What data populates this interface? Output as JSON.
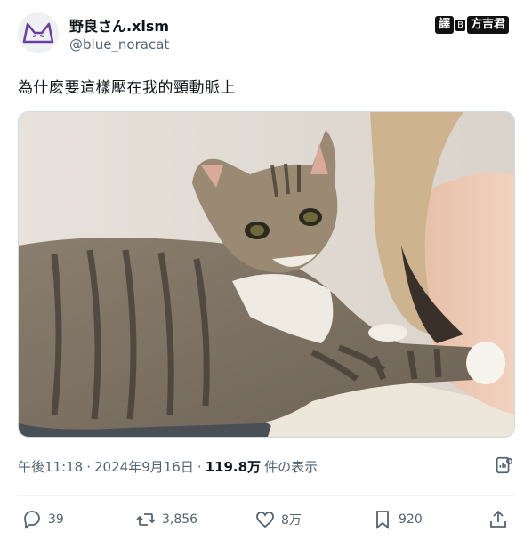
{
  "author": {
    "display_name": "野良さん.xlsm",
    "handle": "@blue_noracat"
  },
  "watermark": {
    "left": "譯",
    "mid": "B",
    "right": "方吉君"
  },
  "tweet": {
    "text": "為什麽要這樣壓在我的頸動脈上"
  },
  "meta": {
    "time": "午後11:18",
    "sep1": "·",
    "date": "2024年9月16日",
    "sep2": "·",
    "views": "119.8万",
    "views_suffix": "件の表示"
  },
  "actions": {
    "replies": "39",
    "retweets": "3,856",
    "likes": "8万",
    "bookmarks": "920"
  },
  "icons": {
    "reply": "reply-icon",
    "retweet": "retweet-icon",
    "like": "heart-icon",
    "bookmark": "bookmark-icon",
    "share": "share-icon",
    "analytics": "analytics-icon"
  },
  "colors": {
    "text": "#0f1419",
    "secondary": "#536471",
    "divider": "#eff3f4"
  }
}
